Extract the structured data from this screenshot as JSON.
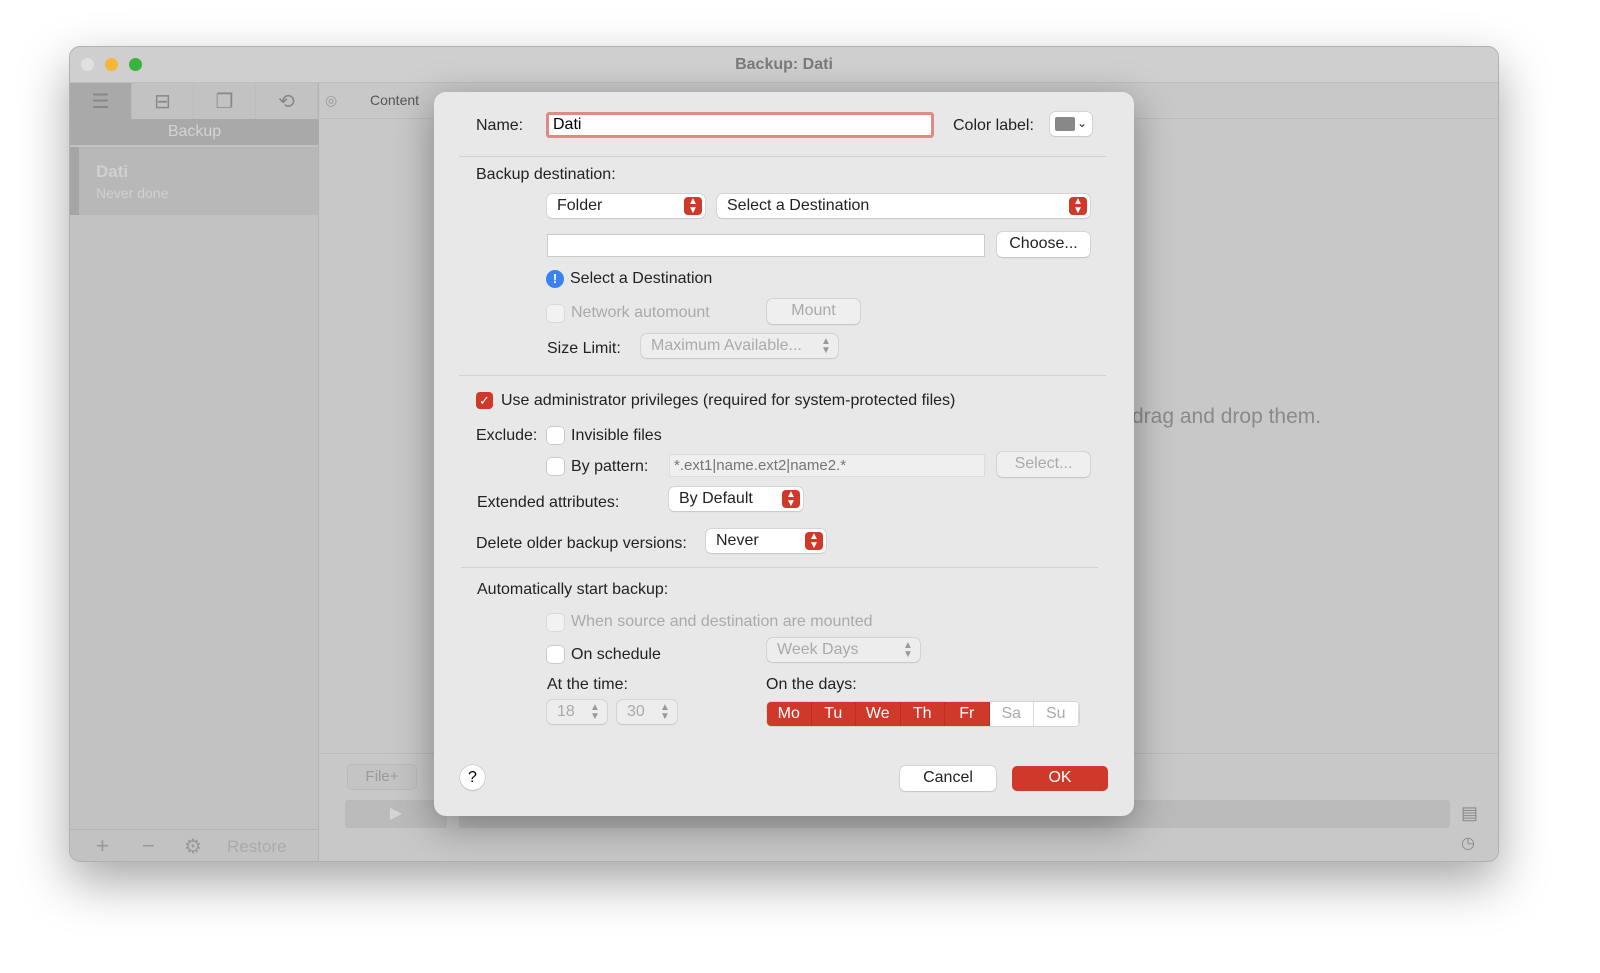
{
  "window": {
    "title": "Backup: Dati"
  },
  "sidebar": {
    "header": "Backup",
    "items": [
      {
        "name": "Dati",
        "status": "Never done"
      }
    ],
    "bottom": {
      "restore": "Restore"
    }
  },
  "main": {
    "tab": "Content",
    "hint": "drag and drop them.",
    "file_plus": "File+"
  },
  "dialog": {
    "name_label": "Name:",
    "name_value": "Dati",
    "color_label": "Color label:",
    "backup_destination_label": "Backup destination:",
    "dest_type": "Folder",
    "dest_select": "Select a Destination",
    "path_value": "",
    "choose": "Choose...",
    "warning": "Select a Destination",
    "network_automount": "Network automount",
    "mount": "Mount",
    "size_limit_label": "Size Limit:",
    "size_limit_value": "Maximum Available...",
    "admin_privileges": "Use administrator privileges (required for system-protected files)",
    "exclude_label": "Exclude:",
    "invisible_files": "Invisible files",
    "by_pattern": "By pattern:",
    "pattern_placeholder": "*.ext1|name.ext2|name2.*",
    "select": "Select...",
    "extended_attributes_label": "Extended attributes:",
    "extended_attributes_value": "By Default",
    "delete_older_label": "Delete older backup versions:",
    "delete_older_value": "Never",
    "auto_start_label": "Automatically start backup:",
    "when_mounted": "When source and destination are mounted",
    "on_schedule": "On schedule",
    "schedule_value": "Week Days",
    "at_time_label": "At the time:",
    "hour": "18",
    "minute": "30",
    "on_days_label": "On the days:",
    "days": [
      {
        "label": "Mo",
        "on": true
      },
      {
        "label": "Tu",
        "on": true
      },
      {
        "label": "We",
        "on": true
      },
      {
        "label": "Th",
        "on": true
      },
      {
        "label": "Fr",
        "on": true
      },
      {
        "label": "Sa",
        "on": false
      },
      {
        "label": "Su",
        "on": false
      }
    ],
    "help": "?",
    "cancel": "Cancel",
    "ok": "OK"
  },
  "colors": {
    "accent": "#d0392a"
  }
}
